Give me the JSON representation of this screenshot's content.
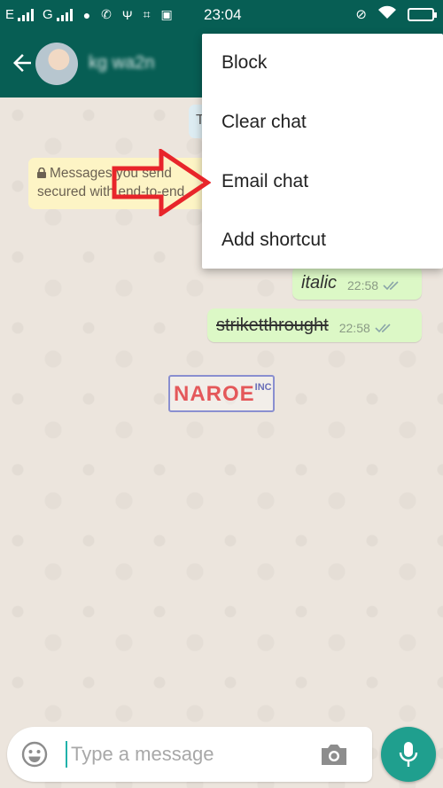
{
  "status_bar": {
    "network1": "E",
    "network2": "G",
    "time": "23:04"
  },
  "header": {
    "contact_name": "kg wa2n"
  },
  "chat": {
    "date_chip": "T",
    "encryption_line1": "Messages you send",
    "encryption_line2": "secured with end-to-end",
    "messages": [
      {
        "text": "italic",
        "time": "22:58"
      },
      {
        "text": "striketthrought",
        "time": "22:58"
      }
    ]
  },
  "menu": {
    "items": [
      "Block",
      "Clear chat",
      "Email chat",
      "Add shortcut"
    ]
  },
  "watermark": {
    "main": "NAROE",
    "sup": "INC"
  },
  "composer": {
    "placeholder": "Type a message"
  },
  "colors": {
    "header": "#075E54",
    "bubble_out": "#DCF8C6",
    "fab": "#1F9F8E",
    "annotation_arrow": "#E8252A"
  }
}
